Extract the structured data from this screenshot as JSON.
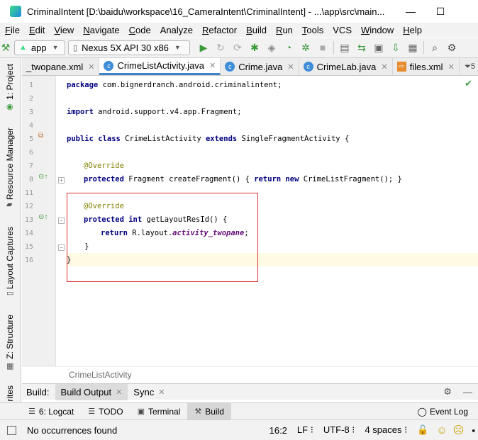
{
  "window": {
    "title": "CriminalIntent [D:\\baidu\\workspace\\16_CameraIntent\\CriminalIntent] - ...\\app\\src\\main...",
    "minimize": "—",
    "maximize": "☐"
  },
  "menu": [
    {
      "mnemonic": "F",
      "rest": "ile"
    },
    {
      "mnemonic": "E",
      "rest": "dit"
    },
    {
      "mnemonic": "V",
      "rest": "iew"
    },
    {
      "mnemonic": "N",
      "rest": "avigate"
    },
    {
      "mnemonic": "C",
      "rest": "ode"
    },
    {
      "mnemonic": "",
      "rest": "Analyze"
    },
    {
      "mnemonic": "R",
      "rest": "efactor"
    },
    {
      "mnemonic": "B",
      "rest": "uild"
    },
    {
      "mnemonic": "R",
      "rest": "un"
    },
    {
      "mnemonic": "T",
      "rest": "ools"
    },
    {
      "mnemonic": "",
      "rest": "VCS"
    },
    {
      "mnemonic": "W",
      "rest": "indow"
    },
    {
      "mnemonic": "H",
      "rest": "elp"
    }
  ],
  "toolbar": {
    "run_config": "app",
    "device": "Nexus 5X API 30 x86"
  },
  "left_tools": {
    "project": "1: Project",
    "resource_manager": "Resource Manager",
    "layout_captures": "Layout Captures",
    "structure": "Z: Structure",
    "favorites": "rites"
  },
  "tabs": [
    {
      "label": "_twopane.xml",
      "type": "xml"
    },
    {
      "label": "CrimeListActivity.java",
      "type": "class",
      "active": true
    },
    {
      "label": "Crime.java",
      "type": "class"
    },
    {
      "label": "CrimeLab.java",
      "type": "class"
    },
    {
      "label": "files.xml",
      "type": "xml"
    }
  ],
  "tab_overflow": "5",
  "editor": {
    "line_numbers": [
      "1",
      "2",
      "3",
      "4",
      "5",
      "6",
      "7",
      "8",
      "11",
      "12",
      "13",
      "14",
      "15",
      "16"
    ],
    "code": {
      "l1_kw": "package",
      "l1_rest": " com.bignerdranch.android.criminalintent;",
      "l3_kw": "import",
      "l3_rest": " android.support.v4.app.Fragment;",
      "l5_kw1": "public class",
      "l5_mid": " CrimeListActivity ",
      "l5_kw2": "extends",
      "l5_rest": " SingleFragmentActivity {",
      "l7_ann": "@Override",
      "l8_kw1": "protected",
      "l8_mid": " Fragment createFragment() { ",
      "l8_kw2": "return new",
      "l8_rest": " CrimeListFragment(); }",
      "l12_ann": "@Override",
      "l13_kw1": "protected int",
      "l13_rest": " getLayoutResId() {",
      "l14_kw": "return",
      "l14_mid": " R.layout.",
      "l14_field": "activity_twopane",
      "l14_rest": ";",
      "l15": "    }",
      "l16": "}"
    }
  },
  "breadcrumb": "CrimeListActivity",
  "build_panel": {
    "label": "Build:",
    "tabs": [
      "Build Output",
      "Sync"
    ]
  },
  "bottom_tools": [
    {
      "label": "6: Logcat",
      "icon": "logcat-icon"
    },
    {
      "label": "TODO",
      "icon": "todo-icon"
    },
    {
      "label": "Terminal",
      "icon": "terminal-icon"
    },
    {
      "label": "Build",
      "icon": "hammer-icon",
      "active": true
    }
  ],
  "event_log": "Event Log",
  "status": {
    "message": "No occurrences found",
    "position": "16:2",
    "line_sep": "LF",
    "encoding": "UTF-8",
    "indent": "4 spaces"
  }
}
